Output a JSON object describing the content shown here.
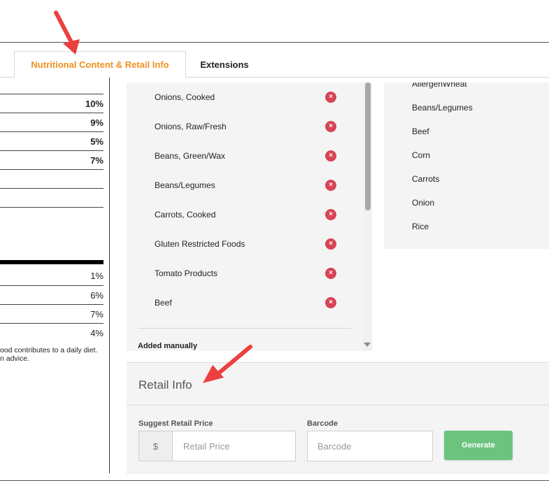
{
  "tabs": [
    {
      "label": "Nutritional Content & Retail Info",
      "active": true
    },
    {
      "label": "Extensions",
      "active": false
    }
  ],
  "nutrition": {
    "rows": [
      {
        "value": "10%",
        "bold": true
      },
      {
        "value": "9%",
        "bold": true
      },
      {
        "value": "5%",
        "bold": true
      },
      {
        "value": "7%",
        "bold": true
      },
      {
        "value": "",
        "bold": false
      },
      {
        "value": "",
        "bold": false
      },
      {
        "value": "1%",
        "bold": false
      },
      {
        "value": "6%",
        "bold": false
      },
      {
        "value": "7%",
        "bold": false
      },
      {
        "value": "4%",
        "bold": false
      }
    ],
    "footnote_line1": "ood contributes to a daily diet.",
    "footnote_line2": "n advice."
  },
  "allergens": {
    "items": [
      "Onions, Cooked",
      "Onions, Raw/Fresh",
      "Beans, Green/Wax",
      "Beans/Legumes",
      "Carrots, Cooked",
      "Gluten Restricted Foods",
      "Tomato Products",
      "Beef"
    ],
    "remove_glyph": "×",
    "added_manually_label": "Added manually"
  },
  "tags": {
    "items": [
      "AllergenWheat",
      "Beans/Legumes",
      "Beef",
      "Corn",
      "Carrots",
      "Onion",
      "Rice"
    ]
  },
  "retail": {
    "title": "Retail Info",
    "price_label": "Suggest Retail Price",
    "currency_symbol": "$",
    "price_placeholder": "Retail Price",
    "barcode_label": "Barcode",
    "barcode_placeholder": "Barcode",
    "generate_label": "Generate"
  },
  "colors": {
    "accent": "#f0901e",
    "remove": "#d84355",
    "generate": "#6cc37e",
    "annotation_arrow": "#ec4040"
  }
}
